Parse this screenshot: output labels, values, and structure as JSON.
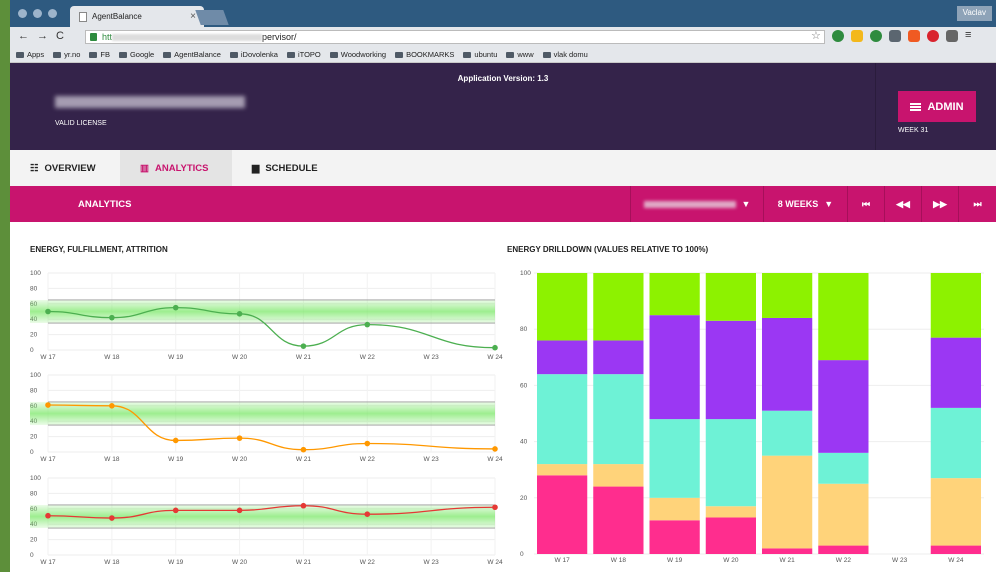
{
  "browser": {
    "tab_title": "AgentBalance",
    "tab_close": "×",
    "user_button": "Vaclav",
    "url_prefix": "htt",
    "url_suffix": "pervisor/",
    "bookmarks": [
      "Apps",
      "yr.no",
      "FB",
      "Google",
      "AgentBalance",
      "iDovolenka",
      "iTOPO",
      "Woodworking",
      "BOOKMARKS",
      "ubuntu",
      "www",
      "vlak domu"
    ]
  },
  "header": {
    "version": "Application Version: 1.3",
    "license": "VALID LICENSE",
    "admin_label": "ADMIN",
    "week": "WEEK 31"
  },
  "main_tabs": [
    {
      "label": "OVERVIEW",
      "active": false
    },
    {
      "label": "ANALYTICS",
      "active": true
    },
    {
      "label": "SCHEDULE",
      "active": false
    }
  ],
  "toolbar": {
    "title": "ANALYTICS",
    "range": "8 WEEKS",
    "dropdown_arrow": "▼"
  },
  "colors": {
    "accent": "#c8146e",
    "header_bg": "#34234a",
    "green": "#4caf50",
    "orange": "#ff9800",
    "red": "#e53935",
    "band": "#7de86a"
  },
  "chart_data": [
    {
      "type": "line",
      "title": "ENERGY, FULFILLMENT, ATTRITION",
      "categories": [
        "W 17",
        "W 18",
        "W 19",
        "W 20",
        "W 21",
        "W 22",
        "W 23",
        "W 24"
      ],
      "ylim": [
        0,
        100
      ],
      "yticks": [
        0,
        20,
        40,
        60,
        80,
        100
      ],
      "panels": [
        {
          "color": "#4caf50",
          "band": [
            35,
            65
          ],
          "x": [
            "W 17",
            "W 18",
            "W 19",
            "W 20",
            "W 21",
            "W 22",
            "W 24"
          ],
          "values": [
            50,
            42,
            55,
            47,
            5,
            33,
            3
          ]
        },
        {
          "color": "#ff9800",
          "band": [
            35,
            65
          ],
          "x": [
            "W 17",
            "W 18",
            "W 19",
            "W 20",
            "W 21",
            "W 22",
            "W 24"
          ],
          "values": [
            61,
            60,
            15,
            18,
            3,
            11,
            4
          ]
        },
        {
          "color": "#e53935",
          "band": [
            35,
            65
          ],
          "x": [
            "W 17",
            "W 18",
            "W 19",
            "W 20",
            "W 21",
            "W 22",
            "W 24"
          ],
          "values": [
            51,
            48,
            58,
            58,
            64,
            53,
            62
          ]
        }
      ]
    },
    {
      "type": "bar",
      "title": "ENERGY DRILLDOWN (VALUES RELATIVE TO 100%)",
      "stacked": true,
      "categories": [
        "W 17",
        "W 18",
        "W 19",
        "W 20",
        "W 21",
        "W 22",
        "W 23",
        "W 24"
      ],
      "ylim": [
        0,
        100
      ],
      "yticks": [
        0,
        20,
        40,
        60,
        80,
        100
      ],
      "series": [
        {
          "color": "#ff2d8e",
          "values": [
            28,
            24,
            12,
            13,
            2,
            3,
            0,
            3
          ]
        },
        {
          "color": "#ffd37a",
          "values": [
            4,
            8,
            8,
            4,
            33,
            22,
            0,
            24
          ]
        },
        {
          "color": "#6ef2d6",
          "values": [
            32,
            32,
            28,
            31,
            16,
            11,
            0,
            25
          ]
        },
        {
          "color": "#9b37f3",
          "values": [
            12,
            12,
            37,
            35,
            33,
            33,
            0,
            25
          ]
        },
        {
          "color": "#8df200",
          "values": [
            24,
            24,
            15,
            17,
            16,
            31,
            0,
            23
          ]
        }
      ]
    }
  ]
}
